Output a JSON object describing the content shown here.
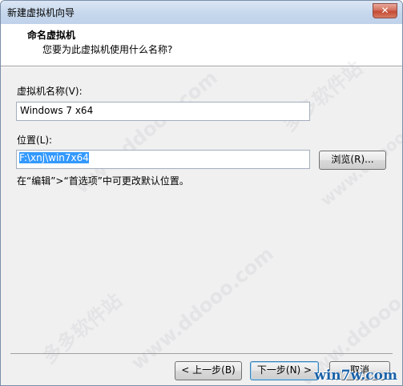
{
  "window": {
    "title": "新建虚拟机向导",
    "close_glyph": "✕"
  },
  "header": {
    "title": "命名虚拟机",
    "subtitle": "您要为此虚拟机使用什么名称?"
  },
  "vm_name": {
    "label": "虚拟机名称(V):",
    "value": "Windows 7 x64"
  },
  "location": {
    "label": "位置(L):",
    "value": "F:\\xnj\\win7x64"
  },
  "browse_button": "浏览(R)...",
  "hint": "在“编辑”>“首选项”中可更改默认位置。",
  "buttons": {
    "back": "< 上一步(B)",
    "next": "下一步(N) >",
    "cancel": "取消"
  },
  "watermarks": {
    "site_cn": "多多软件站",
    "site_url": "www.ddooo.com",
    "corner_logo": "win7w.com"
  }
}
